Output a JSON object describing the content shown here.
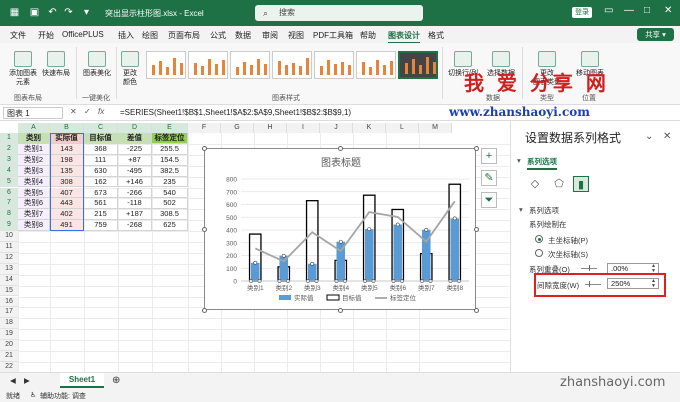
{
  "titlebar": {
    "autosave_label": "",
    "doc_title": "突出显示柱形图.xlsx - Excel",
    "search_placeholder": "搜索",
    "login": "登录"
  },
  "menu": {
    "items": [
      "文件",
      "开始",
      "OfficePLUS",
      "插入",
      "绘图",
      "页面布局",
      "公式",
      "数据",
      "审阅",
      "视图",
      "PDF工具箱",
      "帮助",
      "图表设计",
      "格式"
    ],
    "active": "图表设计",
    "share": "共享"
  },
  "ribbon": {
    "add_element": "添加图表\n元素",
    "quick_layout": "快速布局",
    "beautify": "图表美化",
    "change_colors": "更改\n颜色",
    "switch_row_col": "切换行/列",
    "select_data": "选择数据",
    "change_type": "更改\n图表类型",
    "move_chart": "移动图表",
    "groups": {
      "layout": "图表布局",
      "beautify": "一键美化",
      "styles": "图表样式",
      "data": "数据",
      "type": "类型",
      "location": "位置"
    }
  },
  "formula_bar": {
    "name_box": "图表 1",
    "formula": "=SERIES(Sheet1!$B$1,Sheet1!$A$2:$A$9,Sheet1!$B$2:$B$9,1)"
  },
  "sheet": {
    "columns": [
      "A",
      "B",
      "C",
      "D",
      "E",
      "F",
      "G",
      "H",
      "I",
      "J",
      "K",
      "L",
      "M"
    ],
    "rows": [
      "1",
      "2",
      "3",
      "4",
      "5",
      "6",
      "7",
      "8",
      "9",
      "10",
      "11",
      "12",
      "13",
      "14",
      "15",
      "16",
      "17",
      "18",
      "19",
      "20",
      "21",
      "22"
    ],
    "headers": [
      "类别",
      "实际值",
      "目标值",
      "差值",
      "标签定位"
    ],
    "data": [
      [
        "类别1",
        "143",
        "368",
        "-225",
        "255.5"
      ],
      [
        "类别2",
        "198",
        "111",
        "+87",
        "154.5"
      ],
      [
        "类别3",
        "135",
        "630",
        "-495",
        "382.5"
      ],
      [
        "类别4",
        "308",
        "162",
        "+146",
        "235"
      ],
      [
        "类别5",
        "407",
        "673",
        "-266",
        "540"
      ],
      [
        "类别6",
        "443",
        "561",
        "-118",
        "502"
      ],
      [
        "类别7",
        "402",
        "215",
        "+187",
        "308.5"
      ],
      [
        "类别8",
        "491",
        "759",
        "-268",
        "625"
      ]
    ]
  },
  "chart_data": {
    "type": "bar",
    "title": "图表标题",
    "categories": [
      "类别1",
      "类别2",
      "类别3",
      "类别4",
      "类别5",
      "类别6",
      "类别7",
      "类别8"
    ],
    "series": [
      {
        "name": "实际值",
        "values": [
          143,
          198,
          135,
          308,
          407,
          443,
          402,
          491
        ],
        "color": "#5b9bd5"
      },
      {
        "name": "目标值",
        "values": [
          368,
          111,
          630,
          162,
          673,
          561,
          215,
          759
        ],
        "color": "#000000"
      },
      {
        "name": "标签定位",
        "values": [
          255.5,
          154.5,
          382.5,
          235,
          540,
          502,
          308.5,
          625
        ],
        "color": "#a5a5a5",
        "type": "line"
      }
    ],
    "ylim": [
      0,
      800
    ],
    "yticks": [
      "0",
      "100",
      "200",
      "300",
      "400",
      "500",
      "600",
      "700",
      "800"
    ],
    "legend": "bottom",
    "grid": true
  },
  "pane": {
    "title": "设置数据系列格式",
    "tab": "系列选项",
    "section": "系列选项",
    "plot_on": "系列绘制在",
    "primary_axis": "主坐标轴(P)",
    "secondary_axis": "次坐标轴(S)",
    "overlap_label": "系列重叠(O)",
    "overlap_value": ".00%",
    "gap_label": "间隙宽度(W)",
    "gap_value": "250%"
  },
  "sheet_tab": "Sheet1",
  "status": {
    "ready": "就绪",
    "accessibility": "辅助功能: 调查"
  },
  "watermarks": {
    "cn": "我 爱 分享 网",
    "url": "www.zhanshaoyi.com",
    "corner": "zhanshaoyi.com"
  }
}
